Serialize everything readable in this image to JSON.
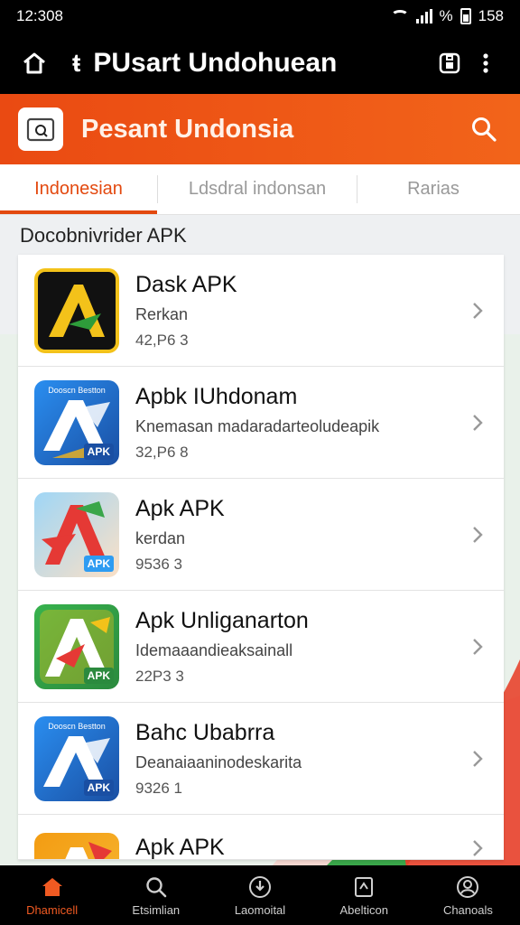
{
  "status": {
    "time": "12:308",
    "battery": "158",
    "extra": "%"
  },
  "app_bar": {
    "title": "PUsart Undohuean"
  },
  "header": {
    "title": "Pesant Undonsia"
  },
  "tabs": [
    {
      "label": "Indonesian",
      "active": true
    },
    {
      "label": "Ldsdral indonsan",
      "active": false
    },
    {
      "label": "Rarias",
      "active": false
    }
  ],
  "section": {
    "title": "Docobnivrider APK"
  },
  "apps": [
    {
      "name": "Dask APK",
      "desc": "Rerkan",
      "meta": "42,P6 3",
      "icon": "dask-apk-icon",
      "icon_colors": [
        "#f3c21a",
        "#111111"
      ]
    },
    {
      "name": "Apbk IUhdonam",
      "desc": "Knemasan madaradarteoludeapik",
      "meta": "32,P6 8",
      "icon": "apbk-icon",
      "icon_caption": "APK",
      "icon_top": "Dooscn Bestton",
      "icon_colors": [
        "#1f6fd0",
        "#ffffff"
      ]
    },
    {
      "name": "Apk APK",
      "desc": "kerdan",
      "meta": "9536 3",
      "icon": "apk-icon",
      "icon_caption": "APK",
      "icon_colors": [
        "#e53935",
        "#2e9cf2"
      ]
    },
    {
      "name": "Apk Unliganarton",
      "desc": "Idemaaandieaksainall",
      "meta": "22P3 3",
      "icon": "apk-unliganarton-icon",
      "icon_caption": "APK",
      "icon_colors": [
        "#37b24d",
        "#f3c21a"
      ]
    },
    {
      "name": "Bahc Ubabrra",
      "desc": "Deanaiaaninodeskarita",
      "meta": "9326 1",
      "icon": "bahc-icon",
      "icon_caption": "APK",
      "icon_top": "Dooscn Bestton",
      "icon_colors": [
        "#1f6fd0",
        "#ffffff"
      ]
    },
    {
      "name": "Apk APK",
      "desc": "",
      "meta": "",
      "icon": "apk-apk-icon",
      "icon_colors": [
        "#f39c12",
        "#e53935"
      ]
    }
  ],
  "bottom_nav": [
    {
      "label": "Dhamicell",
      "icon": "home-icon",
      "active": true
    },
    {
      "label": "Etsimlian",
      "icon": "search-icon",
      "active": false
    },
    {
      "label": "Laomoital",
      "icon": "download-icon",
      "active": false
    },
    {
      "label": "Abelticon",
      "icon": "file-icon",
      "active": false
    },
    {
      "label": "Chanoals",
      "icon": "profile-icon",
      "active": false
    }
  ],
  "colors": {
    "accent": "#e3490f",
    "bar": "#000000",
    "header_gradient": [
      "#ea4a12",
      "#f2641a"
    ]
  }
}
